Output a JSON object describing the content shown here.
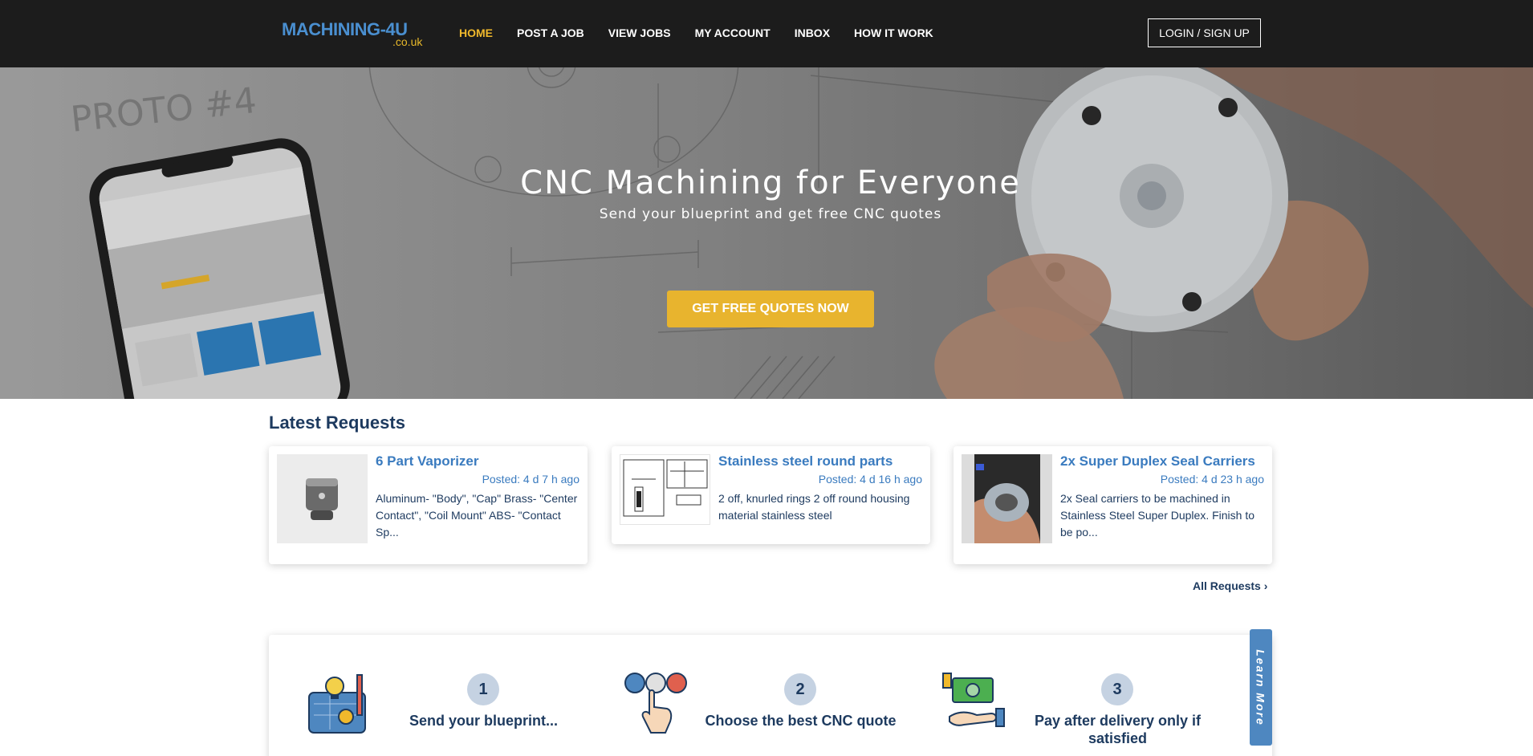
{
  "header": {
    "logo_main": "MACHINING-4U",
    "logo_sub": ".co.uk",
    "nav": [
      {
        "label": "HOME",
        "active": true
      },
      {
        "label": "POST A JOB",
        "active": false
      },
      {
        "label": "VIEW JOBS",
        "active": false
      },
      {
        "label": "MY ACCOUNT",
        "active": false
      },
      {
        "label": "INBOX",
        "active": false
      },
      {
        "label": "HOW IT WORK",
        "active": false
      }
    ],
    "login_label": "LOGIN / SIGN UP"
  },
  "hero": {
    "title": "CNC Machining for Everyone",
    "subtitle": "Send your blueprint and get free CNC quotes",
    "cta_label": "GET FREE QUOTES NOW",
    "sketch_text": "PROTO #4"
  },
  "latest": {
    "title": "Latest Requests",
    "cards": [
      {
        "title": "6 Part Vaporizer",
        "posted": "Posted: 4 d 7 h ago",
        "desc": "Aluminum- \"Body\", \"Cap\" Brass- \"Center Contact\", \"Coil Mount\" ABS- \"Contact Sp...",
        "thumb_icon": "vaporizer-part-image"
      },
      {
        "title": "Stainless steel round parts",
        "posted": "Posted: 4 d 16 h ago",
        "desc": "2 off, knurled rings 2 off round housing material stainless steel",
        "thumb_icon": "technical-drawing-image"
      },
      {
        "title": "2x Super Duplex Seal Carriers",
        "posted": "Posted: 4 d 23 h ago",
        "desc": "2x Seal carriers to be machined in Stainless Steel Super Duplex. Finish to be po...",
        "thumb_icon": "seal-carrier-photo"
      }
    ],
    "all_requests_label": "All Requests",
    "all_requests_icon": "chevron-right-icon"
  },
  "steps": {
    "items": [
      {
        "num": "1",
        "text": "Send your blueprint...",
        "icon": "blueprint-icon"
      },
      {
        "num": "2",
        "text": "Choose the best CNC quote",
        "icon": "choose-person-icon"
      },
      {
        "num": "3",
        "text": "Pay after delivery only if satisfied",
        "icon": "payment-hand-icon"
      }
    ],
    "learn_more": "Learn More"
  },
  "colors": {
    "header_bg": "#1c1c1c",
    "accent_yellow": "#e8b42e",
    "link_blue": "#3a7bbf",
    "navy": "#1d3a5f"
  }
}
